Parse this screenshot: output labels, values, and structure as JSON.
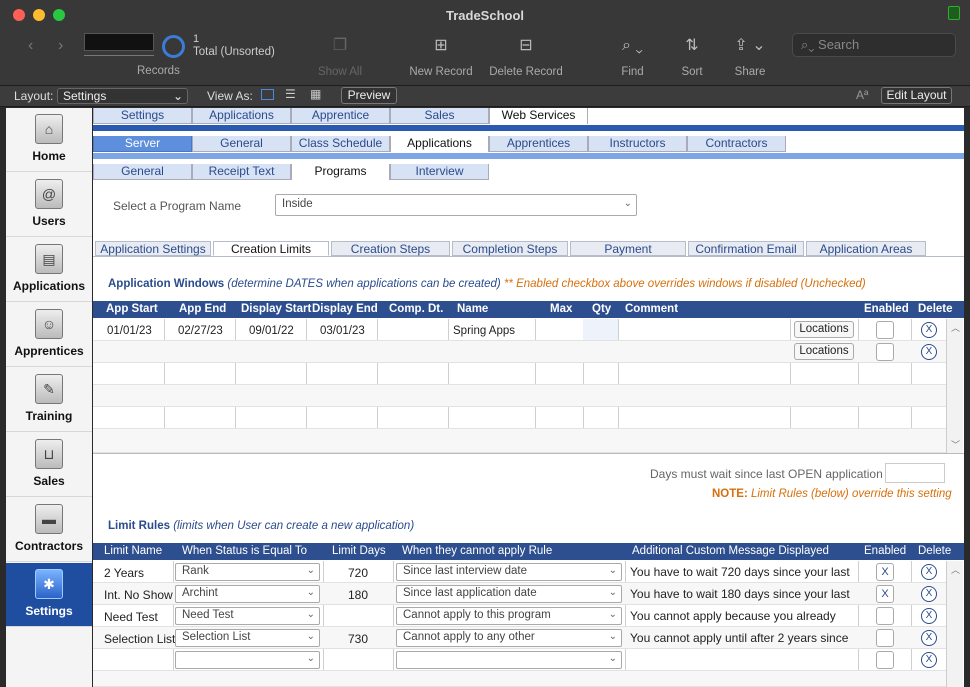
{
  "window": {
    "title": "TradeSchool"
  },
  "toolbar": {
    "record_count": "1",
    "record_status": "Total (Unsorted)",
    "records_label": "Records",
    "show_all": "Show All",
    "new_record": "New Record",
    "delete_record": "Delete Record",
    "find": "Find",
    "sort": "Sort",
    "share": "Share",
    "search_placeholder": "Search"
  },
  "layoutbar": {
    "layout_label": "Layout:",
    "layout_value": "Settings",
    "viewas_label": "View As:",
    "preview": "Preview",
    "edit_layout": "Edit Layout"
  },
  "sidebar": {
    "items": [
      {
        "label": "Home",
        "icon": "home-icon"
      },
      {
        "label": "Users",
        "icon": "address-book-icon"
      },
      {
        "label": "Applications",
        "icon": "clipboard-icon"
      },
      {
        "label": "Apprentices",
        "icon": "id-card-icon"
      },
      {
        "label": "Training",
        "icon": "certificate-icon"
      },
      {
        "label": "Sales",
        "icon": "basket-icon"
      },
      {
        "label": "Contractors",
        "icon": "briefcase-icon"
      },
      {
        "label": "Settings",
        "icon": "settings-icon"
      }
    ]
  },
  "tabs1": [
    "Settings",
    "Applications",
    "Apprentice",
    "Sales",
    "Web Services"
  ],
  "tabs2": [
    "Server",
    "General",
    "Class Schedule",
    "Applications",
    "Apprentices",
    "Instructors",
    "Contractors"
  ],
  "tabs3": [
    "General",
    "Receipt Text",
    "Programs",
    "Interview"
  ],
  "program": {
    "label": "Select a Program Name",
    "value": "Inside"
  },
  "subtabs": [
    "Application Settings",
    "Creation Limits",
    "Creation Steps",
    "Completion Steps",
    "Payment",
    "Confirmation Email",
    "Application Areas"
  ],
  "windows": {
    "title": "Application Windows",
    "subtitle": "(determine DATES when applications can be created)",
    "note": "** Enabled checkbox above overrides windows if disabled (Unchecked)",
    "headers": [
      "App Start",
      "App End",
      "Display Start",
      "Display End",
      "Comp. Dt.",
      "Name",
      "Max",
      "Qty",
      "Comment",
      "Enabled",
      "Delete"
    ],
    "rows": [
      {
        "app_start": "01/01/23",
        "app_end": "02/27/23",
        "display_start": "09/01/22",
        "display_end": "03/01/23",
        "comp_dt": "",
        "name": "Spring Apps",
        "max": "",
        "qty": "",
        "comment": "",
        "button": "Locations",
        "enabled": "",
        "delete": "X"
      },
      {
        "app_start": "",
        "app_end": "",
        "display_start": "",
        "display_end": "",
        "comp_dt": "",
        "name": "",
        "max": "",
        "qty": "",
        "comment": "",
        "button": "Locations",
        "enabled": "",
        "delete": "X"
      }
    ],
    "days_wait_label": "Days must wait since last OPEN application",
    "limit_note_strong": "NOTE:",
    "limit_note": "Limit Rules (below) override this setting"
  },
  "limits": {
    "title": "Limit Rules",
    "subtitle": "(limits when User can create a new application)",
    "headers": [
      "Limit Name",
      "When Status is Equal To",
      "Limit Days",
      "When they cannot apply Rule",
      "Additional Custom Message Displayed",
      "Enabled",
      "Delete"
    ],
    "rows": [
      {
        "name": "2 Years",
        "status": "Rank",
        "days": "720",
        "rule": "Since last interview date",
        "message": "You have to wait 720 days since your last",
        "enabled": "X",
        "delete": "X"
      },
      {
        "name": "Int. No Show",
        "status": "Archint",
        "days": "180",
        "rule": "Since last application date",
        "message": "You have to wait 180 days since your last",
        "enabled": "X",
        "delete": "X"
      },
      {
        "name": "Need Test",
        "status": "Need Test",
        "days": "",
        "rule": "Cannot apply to this program",
        "message": "You cannot apply because you already",
        "enabled": "",
        "delete": "X"
      },
      {
        "name": "Selection List",
        "status": "Selection List",
        "days": "730",
        "rule": "Cannot apply to any other",
        "message": "You cannot apply until after 2 years since",
        "enabled": "",
        "delete": "X"
      },
      {
        "name": "",
        "status": "",
        "days": "",
        "rule": "",
        "message": "",
        "enabled": "",
        "delete": "X"
      }
    ]
  }
}
